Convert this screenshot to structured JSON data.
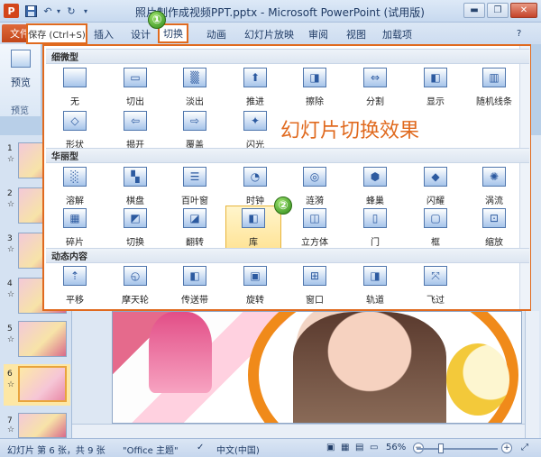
{
  "window": {
    "title": "照片制作成视频PPT.pptx - Microsoft PowerPoint (试用版)",
    "app_icon": "P",
    "qa_icons": [
      "save-icon",
      "undo-icon",
      "redo-icon",
      "customize-icon"
    ]
  },
  "tabs": {
    "file": "文件",
    "items": [
      "插入",
      "设计",
      "切换",
      "动画",
      "幻灯片放映",
      "审阅",
      "视图",
      "加载项"
    ],
    "active": "切换"
  },
  "tooltip": "保存 (Ctrl+S)",
  "badges": [
    "①",
    "②"
  ],
  "ribbon": {
    "preview_label": "预览",
    "group_label": "预览"
  },
  "gallery": {
    "heading": "幻灯片切换效果",
    "sections": [
      {
        "title": "细微型",
        "items": [
          "无",
          "切出",
          "淡出",
          "推进",
          "擦除",
          "分割",
          "显示",
          "随机线条",
          "形状",
          "揭开",
          "覆盖",
          "闪光"
        ]
      },
      {
        "title": "华丽型",
        "items": [
          "溶解",
          "棋盘",
          "百叶窗",
          "时钟",
          "涟漪",
          "蜂巢",
          "闪耀",
          "涡流",
          "碎片",
          "切换",
          "翻转",
          "库",
          "立方体",
          "门",
          "框",
          "缩放"
        ]
      },
      {
        "title": "动态内容",
        "items": [
          "平移",
          "摩天轮",
          "传送带",
          "旋转",
          "窗口",
          "轨道",
          "飞过"
        ]
      }
    ],
    "highlighted": "库"
  },
  "thumbnails": [
    "1",
    "2",
    "3",
    "4",
    "5",
    "6",
    "7"
  ],
  "thumbnail_stars": "☆",
  "selected_slide": "6",
  "status": {
    "slide_info": "幻灯片 第 6 张，共 9 张",
    "theme": "\"Office 主题\"",
    "language": "中文(中国)",
    "zoom": "56%"
  },
  "colors": {
    "accent": "#e06a1f",
    "file_tab": "#c2461a"
  }
}
